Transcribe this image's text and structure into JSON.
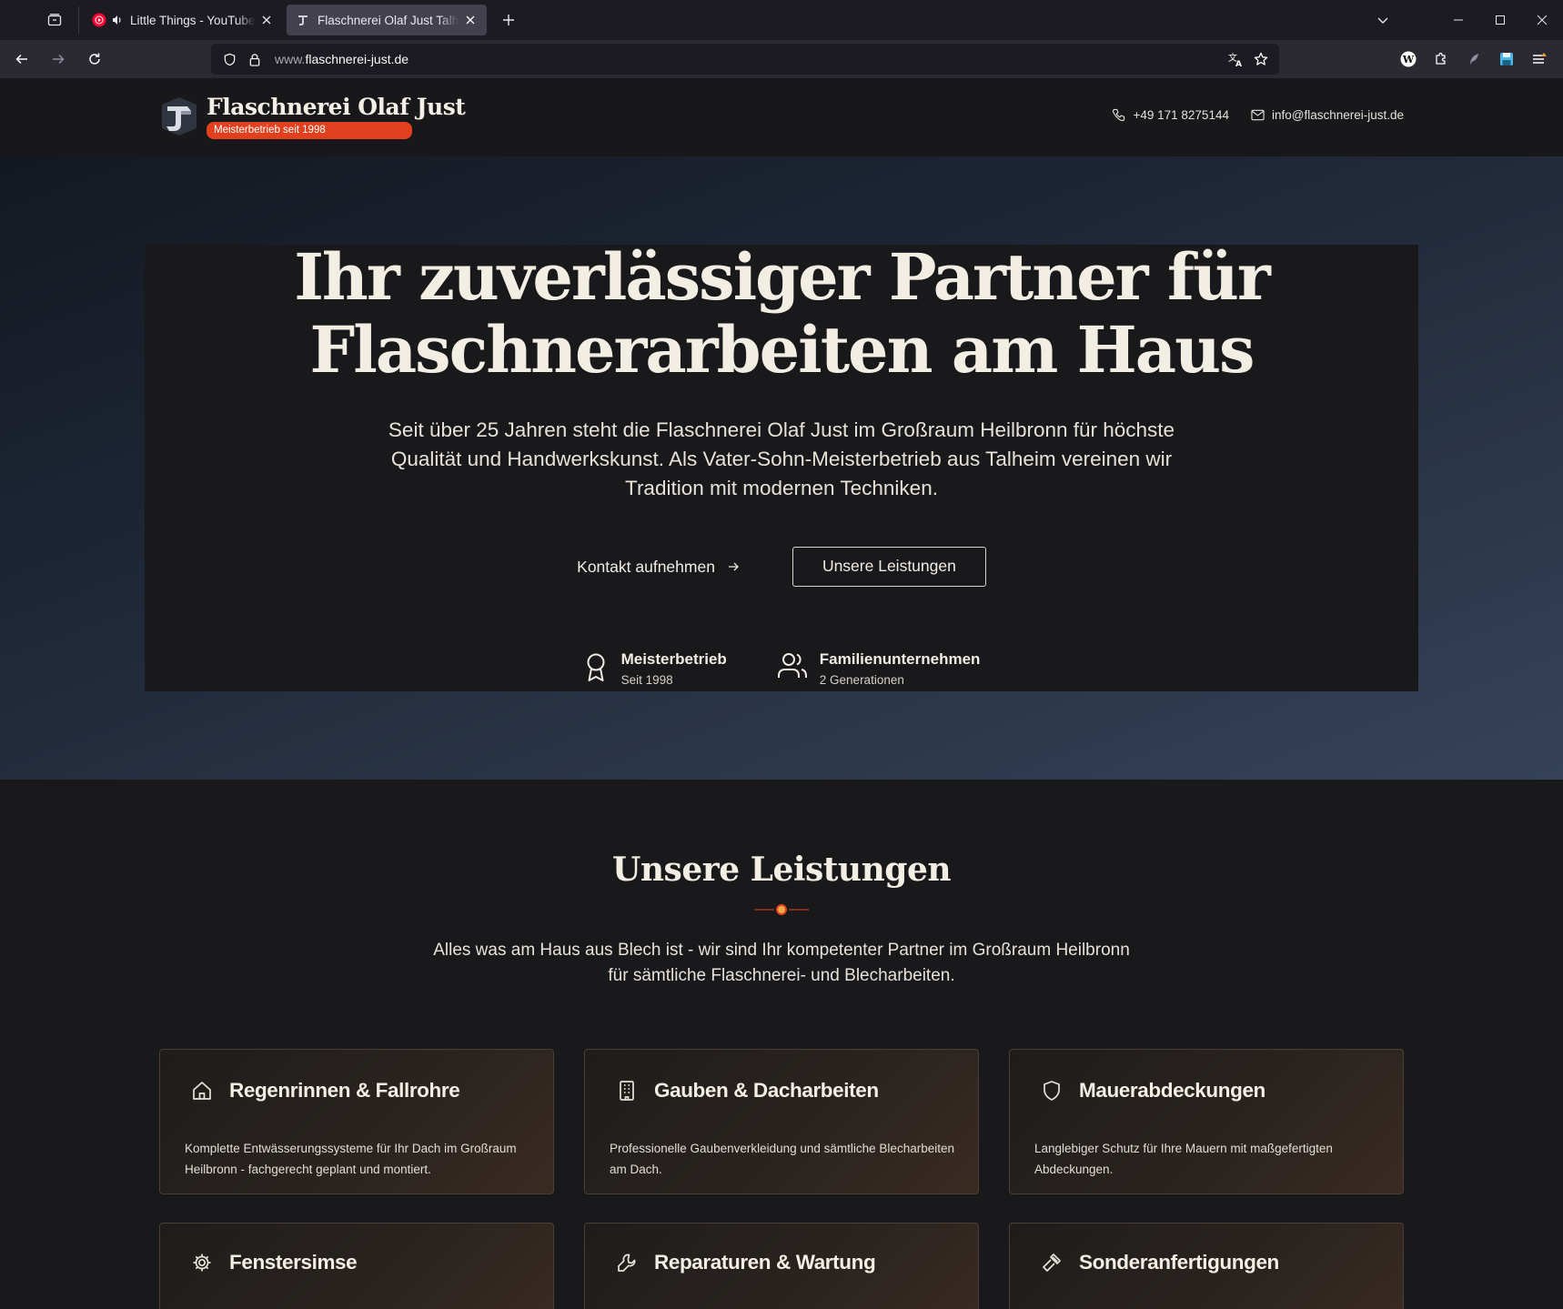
{
  "browser": {
    "tabs": [
      {
        "title": "Little Things - YouTube Music",
        "active": false
      },
      {
        "title": "Flaschnerei Olaf Just Talheim - Meisterbetrieb",
        "active": true
      }
    ],
    "url_prefix": "www.",
    "url_domain": "flaschnerei-just.de"
  },
  "header": {
    "brand_name": "Flaschnerei Olaf Just",
    "badge": "Meisterbetrieb seit 1998",
    "phone": "+49 171 8275144",
    "email": "info@flaschnerei-just.de"
  },
  "hero": {
    "title_line1": "Ihr zuverlässiger Partner für",
    "title_line2": "Flaschnerarbeiten am Haus",
    "subtitle": "Seit über 25 Jahren steht die Flaschnerei Olaf Just im Großraum Heilbronn für höchste Qualität und Handwerkskunst. Als Vater-Sohn-Meisterbetrieb aus Talheim vereinen wir Tradition mit modernen Techniken.",
    "cta_primary": "Kontakt aufnehmen",
    "cta_secondary": "Unsere Leistungen",
    "features": [
      {
        "icon": "award-icon",
        "title": "Meisterbetrieb",
        "sub": "Seit 1998"
      },
      {
        "icon": "users-icon",
        "title": "Familienunternehmen",
        "sub": "2 Generationen"
      }
    ]
  },
  "services": {
    "title": "Unsere Leistungen",
    "subtitle_line1": "Alles was am Haus aus Blech ist - wir sind Ihr kompetenter Partner im Großraum Heilbronn",
    "subtitle_line2": "für sämtliche Flaschnerei- und Blecharbeiten.",
    "cards": [
      {
        "icon": "home-icon",
        "title": "Regenrinnen & Fallrohre",
        "desc": "Komplette Entwässerungssysteme für Ihr Dach im Großraum Heilbronn - fachgerecht geplant und montiert."
      },
      {
        "icon": "building-icon",
        "title": "Gauben & Dacharbeiten",
        "desc": "Professionelle Gaubenverkleidung und sämtliche Blecharbeiten am Dach."
      },
      {
        "icon": "shield-icon",
        "title": "Mauerabdeckungen",
        "desc": "Langlebiger Schutz für Ihre Mauern mit maßgefertigten Abdeckungen."
      },
      {
        "icon": "gear-icon",
        "title": "Fenstersimse",
        "desc": ""
      },
      {
        "icon": "wrench-icon",
        "title": "Reparaturen & Wartung",
        "desc": ""
      },
      {
        "icon": "hammer-icon",
        "title": "Sonderanfertigungen",
        "desc": ""
      }
    ]
  },
  "colors": {
    "accent": "#e1401f",
    "page_bg": "#19191b"
  }
}
